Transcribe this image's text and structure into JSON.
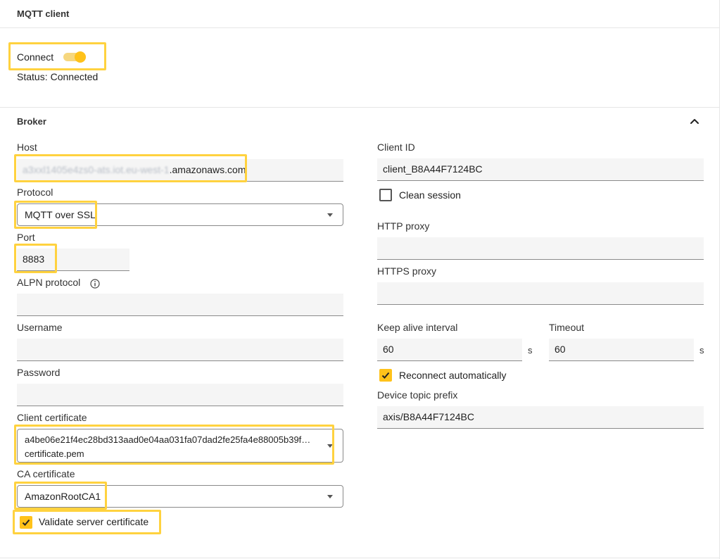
{
  "header": {
    "title": "MQTT client"
  },
  "connection": {
    "connect_label": "Connect",
    "connect_enabled": true,
    "status_label": "Status:",
    "status_value": "Connected"
  },
  "broker": {
    "title": "Broker",
    "host": {
      "label": "Host",
      "value_redacted": "a3xxl1405e4zs0-ats.iot.eu-west-1",
      "value_suffix": ".amazonaws.com"
    },
    "protocol": {
      "label": "Protocol",
      "value": "MQTT over SSL"
    },
    "port": {
      "label": "Port",
      "value": "8883"
    },
    "alpn": {
      "label": "ALPN protocol",
      "value": ""
    },
    "username": {
      "label": "Username",
      "value": ""
    },
    "password": {
      "label": "Password",
      "value": ""
    },
    "client_certificate": {
      "label": "Client certificate",
      "value_line1": "a4be06e21f4ec28bd313aad0e04aa031fa07dad2fe25fa4e88005b39f…",
      "value_line2": "certificate.pem"
    },
    "ca_certificate": {
      "label": "CA certificate",
      "value": "AmazonRootCA1"
    },
    "validate_server_certificate": {
      "label": "Validate server certificate",
      "checked": true
    },
    "client_id": {
      "label": "Client ID",
      "value": "client_B8A44F7124BC"
    },
    "clean_session": {
      "label": "Clean session",
      "checked": false
    },
    "http_proxy": {
      "label": "HTTP proxy",
      "value": ""
    },
    "https_proxy": {
      "label": "HTTPS proxy",
      "value": ""
    },
    "keep_alive": {
      "label": "Keep alive interval",
      "value": "60",
      "unit": "s"
    },
    "timeout": {
      "label": "Timeout",
      "value": "60",
      "unit": "s"
    },
    "reconnect": {
      "label": "Reconnect automatically",
      "checked": true
    },
    "device_topic_prefix": {
      "label": "Device topic prefix",
      "value": "axis/B8A44F7124BC"
    }
  },
  "colors": {
    "accent": "#ffc21a",
    "highlight": "#ffd23f",
    "field_bg": "#f5f5f5"
  }
}
